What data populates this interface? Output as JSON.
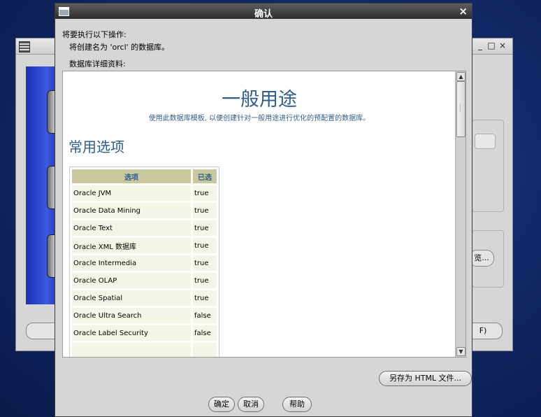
{
  "dialog": {
    "title": "确认",
    "close_glyph": "×",
    "intro_label": "将要执行以下操作:",
    "action_text": "将创建名为 'orcl' 的数据库。",
    "details_label": "数据库详细资料:"
  },
  "content": {
    "title": "一般用途",
    "subtitle": "使用此数据库模板, 以便创建针对一般用途进行优化的预配置的数据库。",
    "section_title": "常用选项",
    "table": {
      "headers": [
        "选项",
        "已选"
      ],
      "rows": [
        [
          "Oracle JVM",
          "true"
        ],
        [
          "Oracle Data Mining",
          "true"
        ],
        [
          "Oracle Text",
          "true"
        ],
        [
          "Oracle XML 数据库",
          "true"
        ],
        [
          "Oracle Intermedia",
          "true"
        ],
        [
          "Oracle OLAP",
          "true"
        ],
        [
          "Oracle Spatial",
          "true"
        ],
        [
          "Oracle Ultra Search",
          "false"
        ],
        [
          "Oracle Label Security",
          "false"
        ]
      ]
    }
  },
  "buttons": {
    "save_html": "另存为 HTML 文件...",
    "ok": "确定",
    "cancel": "取消",
    "help": "帮助"
  },
  "background_window": {
    "controls": [
      "_",
      "□",
      "×"
    ],
    "browse_fragment": "览...",
    "f_fragment": "F)"
  }
}
